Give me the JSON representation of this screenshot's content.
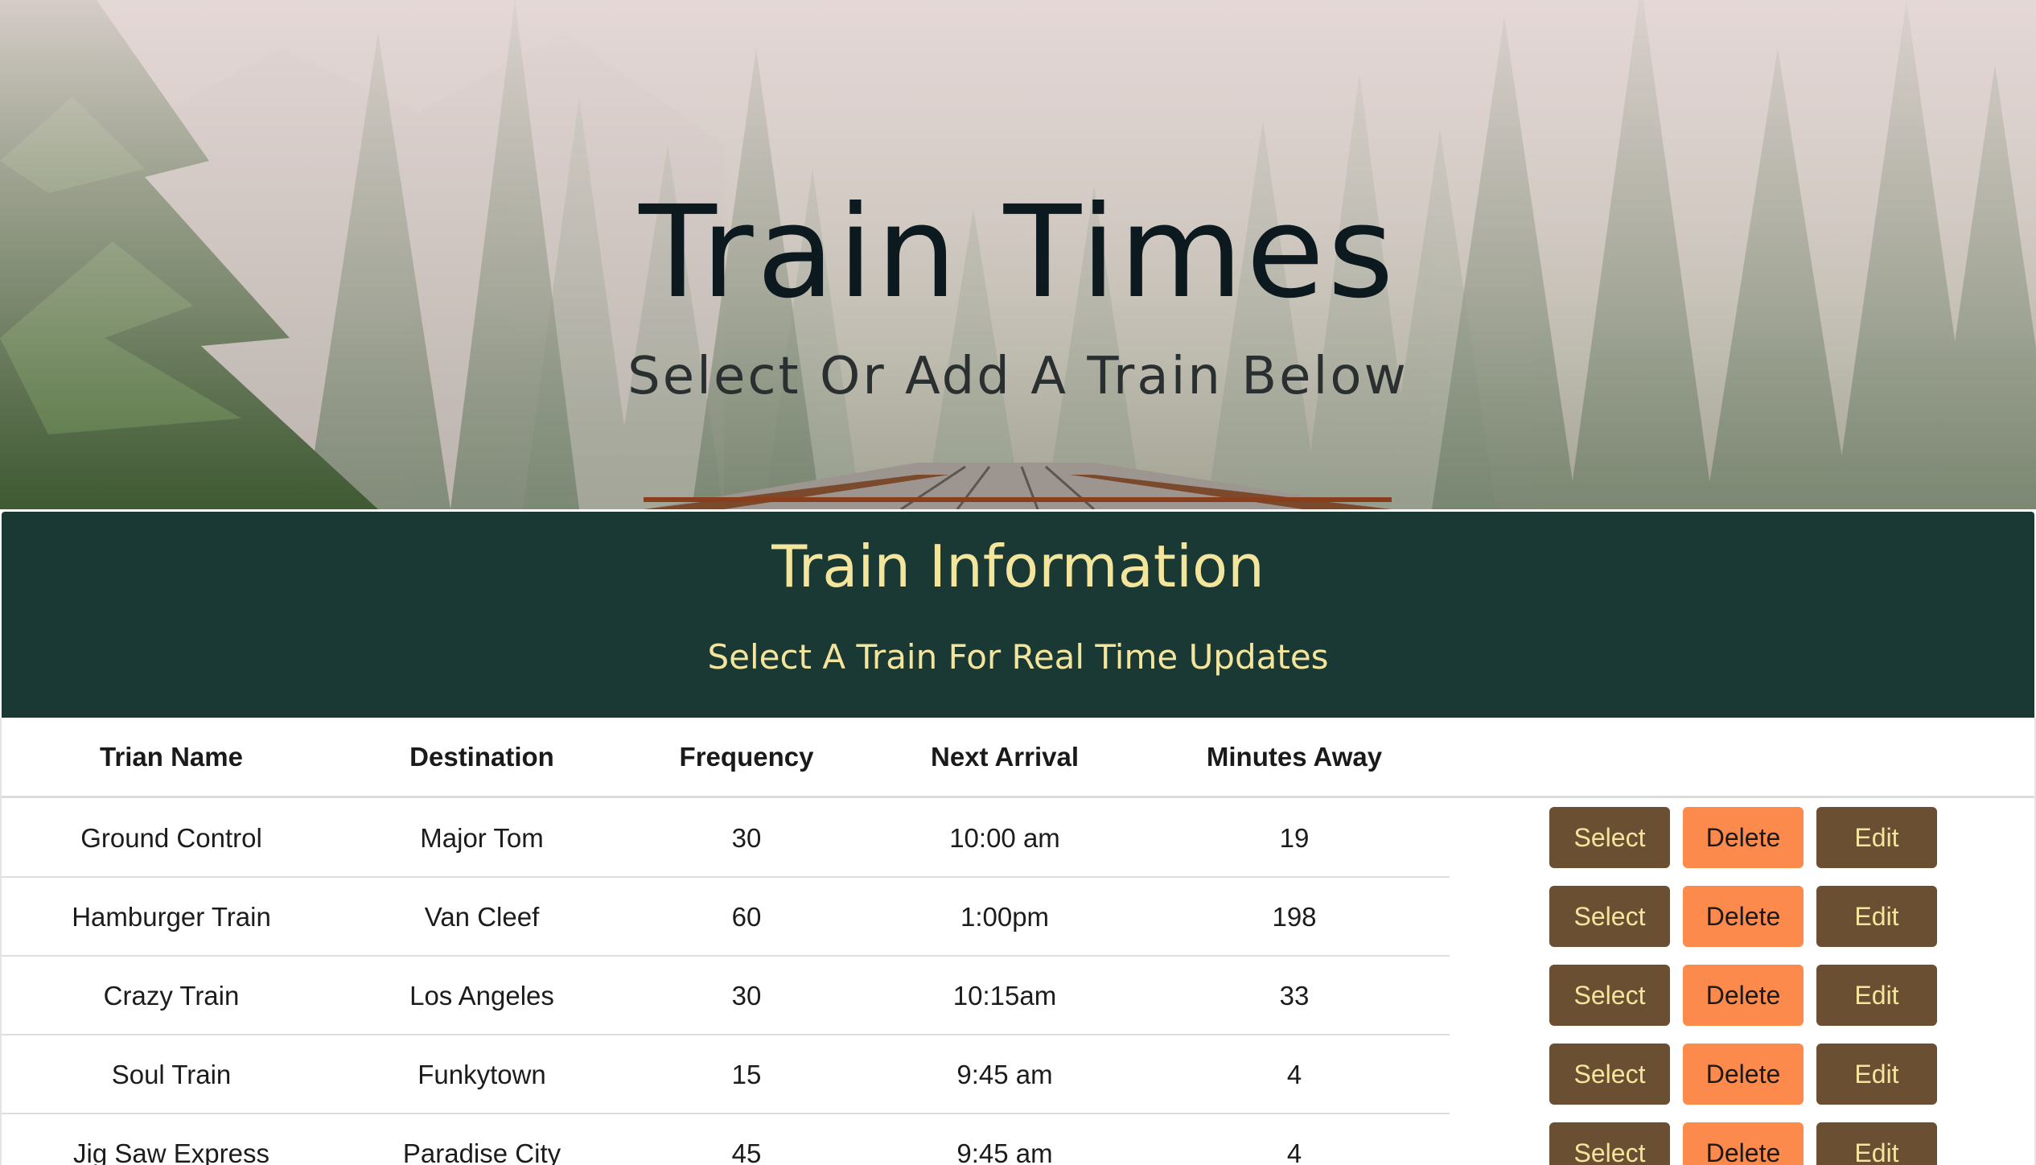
{
  "hero": {
    "title": "Train Times",
    "subtitle": "Select Or Add A Train Below"
  },
  "info": {
    "title": "Train Information",
    "subtitle": "Select A Train For Real Time Updates"
  },
  "table": {
    "columns": [
      "Trian Name",
      "Destination",
      "Frequency",
      "Next Arrival",
      "Minutes Away"
    ],
    "rows": [
      {
        "name": "Ground Control",
        "destination": "Major Tom",
        "frequency": "30",
        "next_arrival": "10:00 am",
        "minutes_away": "19"
      },
      {
        "name": "Hamburger Train",
        "destination": "Van Cleef",
        "frequency": "60",
        "next_arrival": "1:00pm",
        "minutes_away": "198"
      },
      {
        "name": "Crazy Train",
        "destination": "Los Angeles",
        "frequency": "30",
        "next_arrival": "10:15am",
        "minutes_away": "33"
      },
      {
        "name": "Soul Train",
        "destination": "Funkytown",
        "frequency": "15",
        "next_arrival": "9:45 am",
        "minutes_away": "4"
      },
      {
        "name": "Jig Saw Express",
        "destination": "Paradise City",
        "frequency": "45",
        "next_arrival": "9:45 am",
        "minutes_away": "4"
      }
    ],
    "actions": {
      "select_label": "Select",
      "delete_label": "Delete",
      "edit_label": "Edit"
    }
  },
  "colors": {
    "header_bg": "#1b3934",
    "header_text": "#f3e59c",
    "button_brown": "#6b4f33",
    "button_orange": "#fb8a4c"
  }
}
